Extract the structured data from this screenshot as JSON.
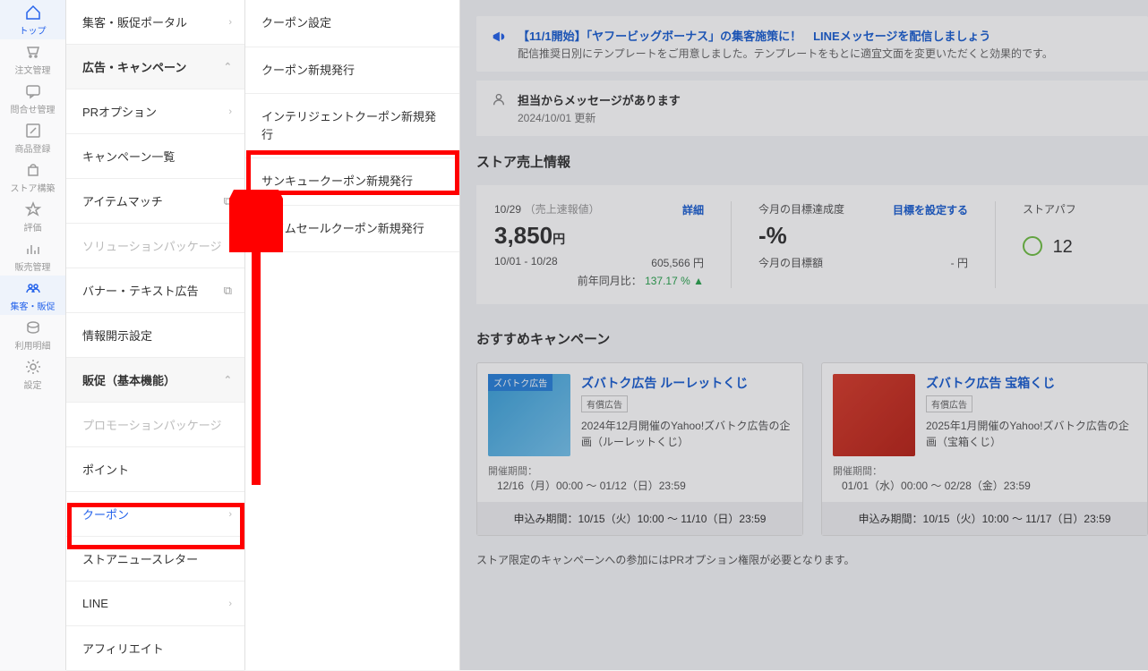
{
  "iconbar": {
    "items": [
      {
        "label": "トップ",
        "name": "top"
      },
      {
        "label": "注文管理",
        "name": "order-mgmt"
      },
      {
        "label": "問合せ管理",
        "name": "inquiry-mgmt"
      },
      {
        "label": "商品登録",
        "name": "item-register"
      },
      {
        "label": "ストア構築",
        "name": "store-build"
      },
      {
        "label": "評価",
        "name": "review"
      },
      {
        "label": "販売管理",
        "name": "sales-mgmt"
      },
      {
        "label": "集客・販促",
        "name": "marketing"
      },
      {
        "label": "利用明細",
        "name": "billing"
      },
      {
        "label": "設定",
        "name": "settings"
      }
    ]
  },
  "menu": {
    "portal": "集客・販促ポータル",
    "campaign_header": "広告・キャンペーン",
    "items": [
      "PRオプション",
      "キャンペーン一覧",
      "アイテムマッチ",
      "ソリューションパッケージ",
      "バナー・テキスト広告",
      "情報開示設定"
    ],
    "promo_header": "販促（基本機能）",
    "promo_items": [
      "プロモーションパッケージ",
      "ポイント",
      "クーポン",
      "ストアニュースレター",
      "LINE",
      "アフィリエイト"
    ]
  },
  "submenu": [
    "クーポン設定",
    "クーポン新規発行",
    "インテリジェントクーポン新規発行",
    "サンキュークーポン新規発行",
    "タイムセールクーポン新規発行"
  ],
  "notice1": {
    "title": "【11/1開始】「ヤフービッグボーナス」の集客施策に！　LINEメッセージを配信しましょう",
    "desc": "配信推奨日別にテンプレートをご用意しました。テンプレートをもとに適宜文面を変更いただくと効果的です。"
  },
  "notice2": {
    "title": "担当からメッセージがあります",
    "date": "2024/10/01 更新"
  },
  "sales": {
    "heading": "ストア売上情報",
    "date_label": "10/29",
    "date_note": "（売上速報値）",
    "amount": "3,850",
    "yen": "円",
    "detail": "詳細",
    "range": "10/01 - 10/28",
    "range_amt": "605,566 円",
    "yoy_label": "前年同月比：",
    "yoy_pct": "137.17 % ▲",
    "goal_label": "今月の目標達成度",
    "goal_pct": "-%",
    "goal_set": "目標を設定する",
    "goal_amt_label": "今月の目標額",
    "goal_amt": "- 円",
    "store_perf": "ストアパフ",
    "store_score": "12"
  },
  "campaign": {
    "heading": "おすすめキャンペーン",
    "cards": [
      {
        "tag": "ズバトク広告",
        "title": "ズバトク広告 ルーレットくじ",
        "badge": "有償広告",
        "desc": "2024年12月開催のYahoo!ズバトク広告の企画（ルーレットくじ）",
        "period_label": "開催期間：",
        "period": "12/16（月）00:00 ～ 01/12（日）23:59",
        "apply": "申込み期間：10/15（火）10:00 ～ 11/10（日）23:59"
      },
      {
        "tag": "",
        "title": "ズバトク広告 宝箱くじ",
        "badge": "有償広告",
        "desc": "2025年1月開催のYahoo!ズバトク広告の企画（宝箱くじ）",
        "period_label": "開催期間：",
        "period": "01/01（水）00:00 ～ 02/28（金）23:59",
        "apply": "申込み期間：10/15（火）10:00 ～ 11/17（日）23:59"
      }
    ],
    "note": "ストア限定のキャンペーンへの参加にはPRオプション権限が必要となります。"
  }
}
